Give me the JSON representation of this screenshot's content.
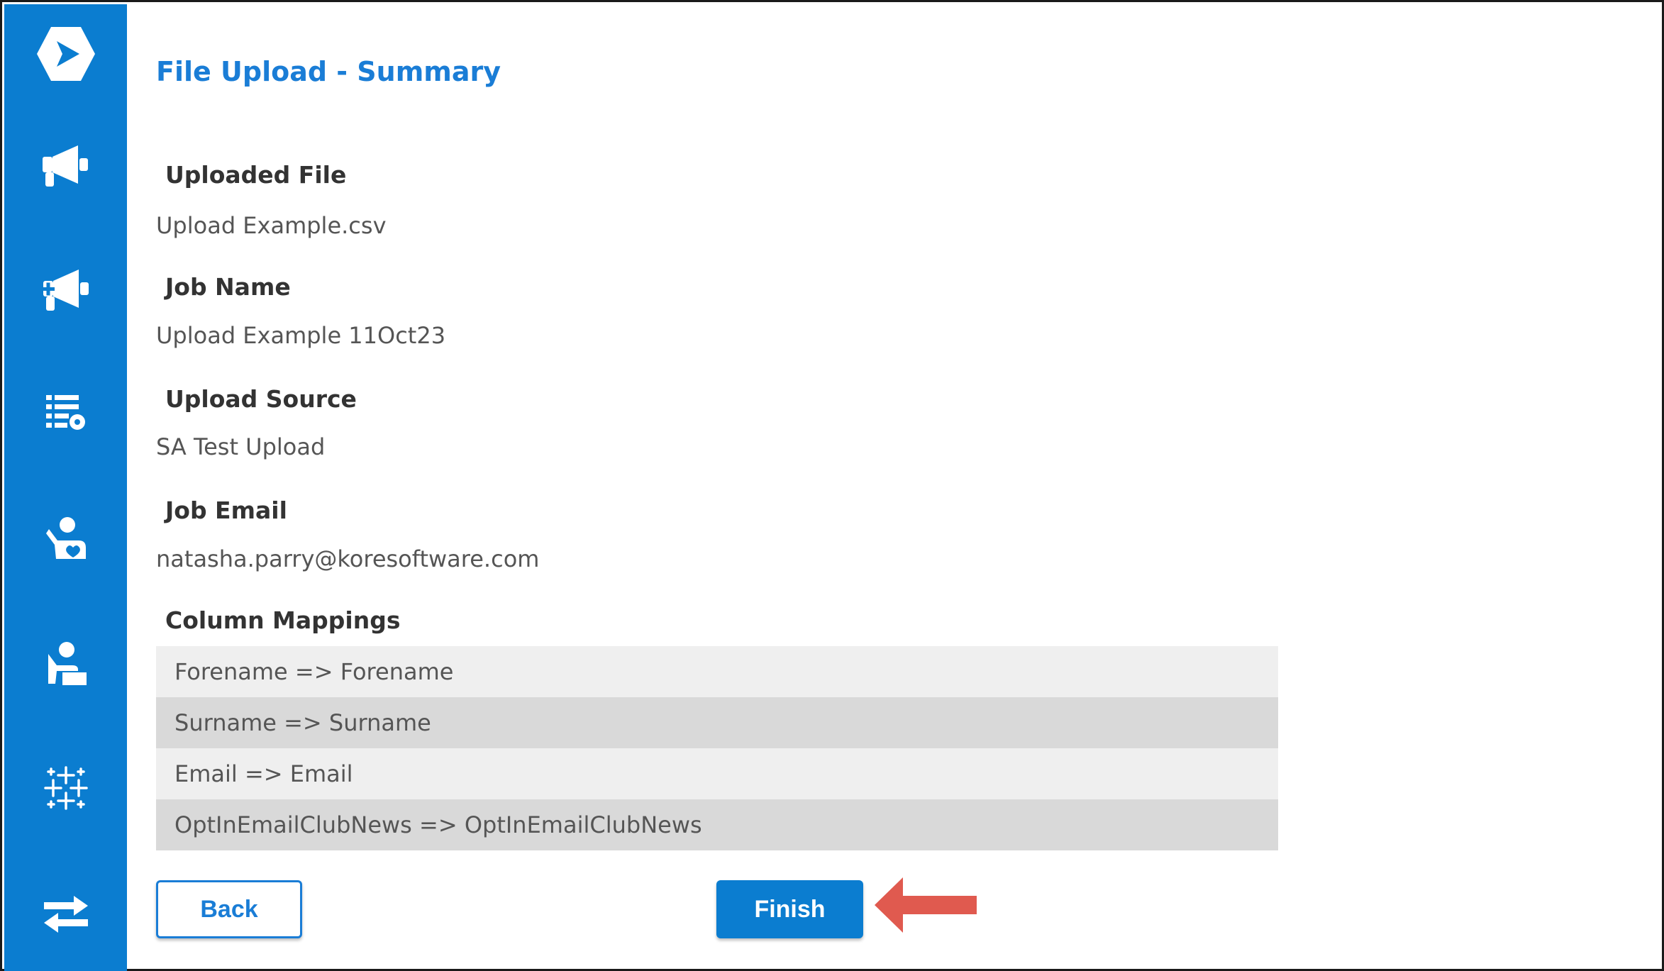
{
  "page": {
    "title": "File Upload - Summary"
  },
  "sidebar": {
    "background": "#0b7dd0",
    "items": [
      {
        "icon": "logo-icon"
      },
      {
        "icon": "megaphone-icon"
      },
      {
        "icon": "megaphone-add-icon"
      },
      {
        "icon": "list-settings-icon"
      },
      {
        "icon": "person-heart-icon"
      },
      {
        "icon": "person-desk-icon"
      },
      {
        "icon": "sparkle-grid-icon"
      },
      {
        "icon": "transfer-arrows-icon"
      }
    ]
  },
  "summary": {
    "uploaded_file": {
      "label": "Uploaded File",
      "value": "Upload Example.csv"
    },
    "job_name": {
      "label": "Job Name",
      "value": "Upload Example 11Oct23"
    },
    "upload_source": {
      "label": "Upload Source",
      "value": "SA Test Upload"
    },
    "job_email": {
      "label": "Job Email",
      "value": "natasha.parry@koresoftware.com"
    },
    "column_mappings": {
      "label": "Column Mappings",
      "rows": [
        "Forename => Forename",
        "Surname => Surname",
        "Email => Email",
        "OptInEmailClubNews => OptInEmailClubNews"
      ]
    }
  },
  "actions": {
    "back_label": "Back",
    "finish_label": "Finish"
  },
  "colors": {
    "accent": "#1a7dd6",
    "annotation_arrow": "#e05a4f"
  }
}
